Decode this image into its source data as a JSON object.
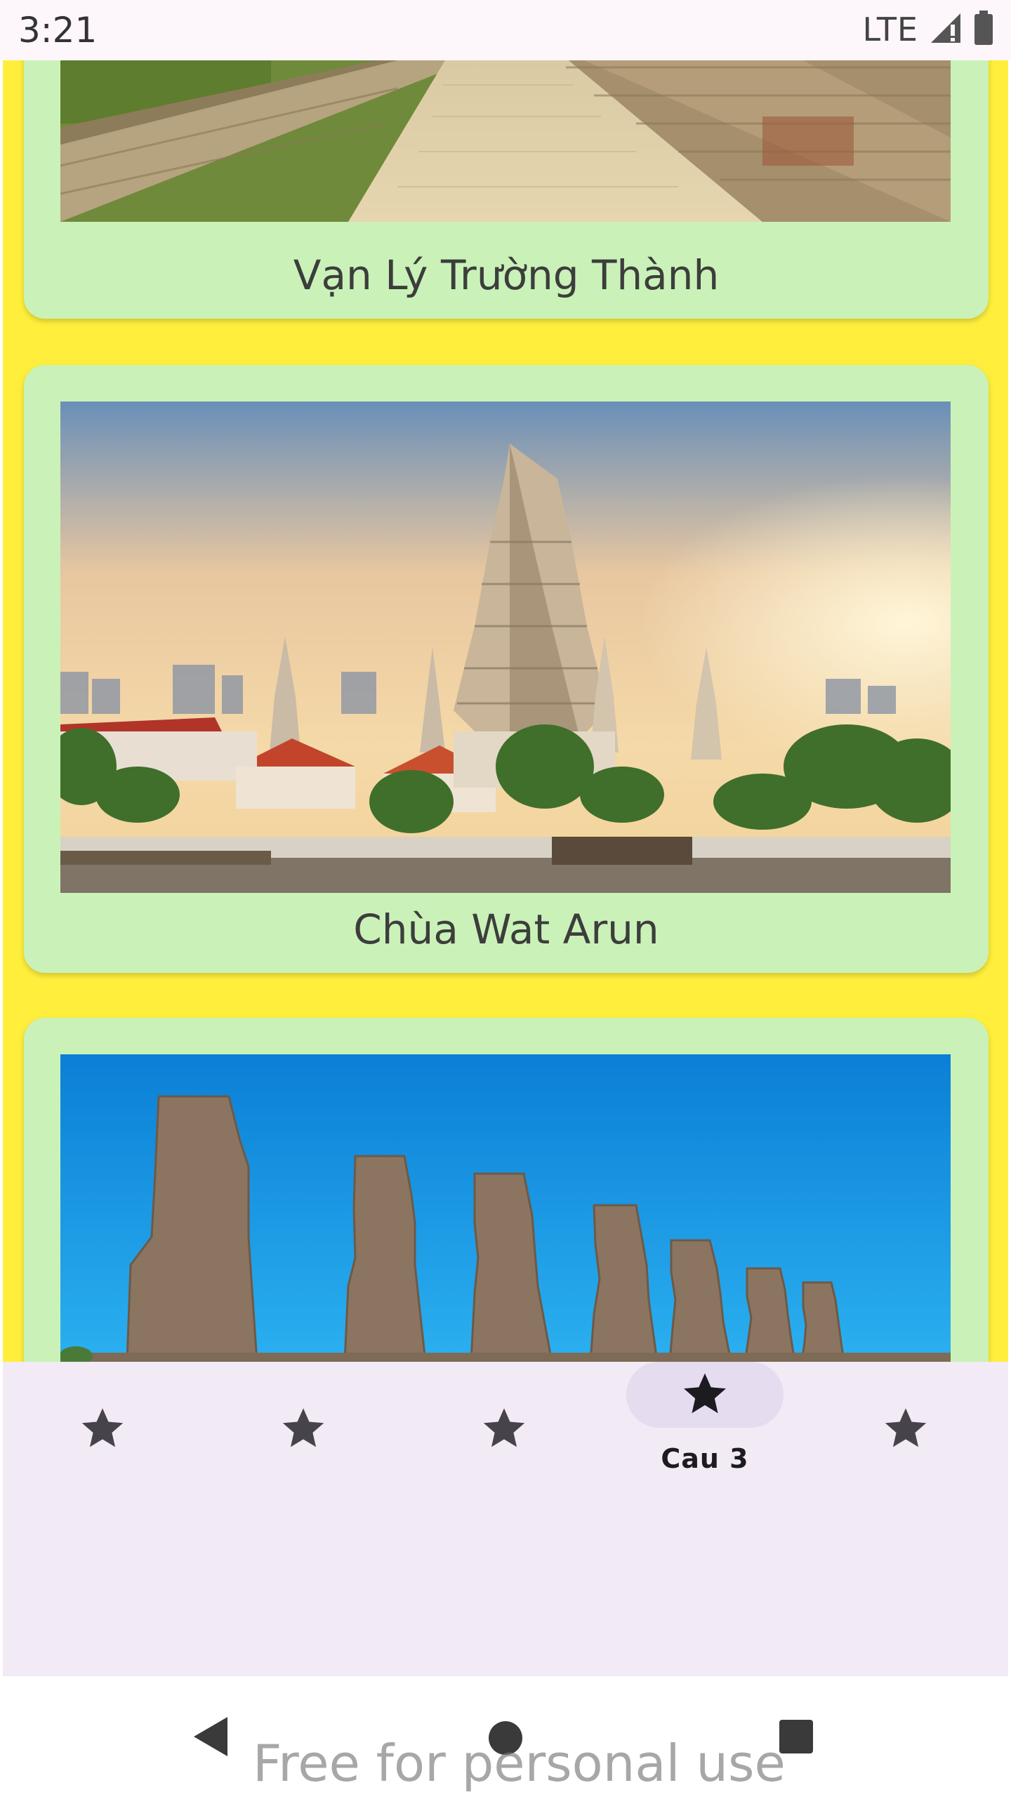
{
  "status_bar": {
    "time": "3:21",
    "network": "LTE",
    "signal_icon": "signal-icon",
    "battery_icon": "battery-icon"
  },
  "cards": [
    {
      "title": "Vạn Lý Trường Thành",
      "image": "great-wall-image"
    },
    {
      "title": "Chùa Wat Arun",
      "image": "wat-arun-image"
    },
    {
      "title": "",
      "image": "moai-statues-image"
    }
  ],
  "bottom_nav": {
    "items": [
      {
        "icon": "star-icon",
        "label": ""
      },
      {
        "icon": "star-icon",
        "label": ""
      },
      {
        "icon": "star-icon",
        "label": ""
      },
      {
        "icon": "star-icon",
        "label": "Cau 3",
        "selected": true
      },
      {
        "icon": "star-icon",
        "label": ""
      }
    ]
  },
  "system_nav": {
    "back_icon": "back-triangle-icon",
    "home_icon": "home-circle-icon",
    "recents_icon": "recents-square-icon"
  },
  "watermark": "Free for personal use",
  "colors": {
    "background": "#ffef3c",
    "card": "#caf2b8",
    "nav_bar": "#f2eaf5",
    "nav_active_pill": "#e5dcf0"
  }
}
